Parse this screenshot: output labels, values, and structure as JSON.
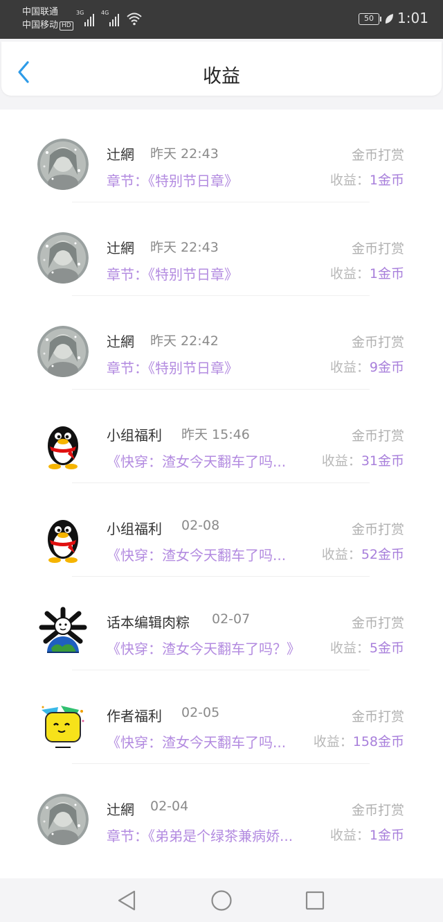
{
  "status_bar": {
    "carrier_1": "中国联通",
    "carrier_2": "中国移动",
    "hd": "HD",
    "net_1": "3G",
    "net_2": "4G",
    "battery": "50",
    "time": "1:01"
  },
  "header": {
    "title": "收益",
    "back_icon": "chevron-left-icon"
  },
  "items": [
    {
      "avatar": "anime-girl",
      "name": "辻網",
      "time": "昨天 22:43",
      "type": "金币打赏",
      "chapter": "章节：《特别节日章》",
      "income_label": "收益：",
      "income_value": "1金币"
    },
    {
      "avatar": "anime-girl",
      "name": "辻網",
      "time": "昨天 22:43",
      "type": "金币打赏",
      "chapter": "章节：《特别节日章》",
      "income_label": "收益：",
      "income_value": "1金币"
    },
    {
      "avatar": "anime-girl",
      "name": "辻網",
      "time": "昨天 22:42",
      "type": "金币打赏",
      "chapter": "章节：《特别节日章》",
      "income_label": "收益：",
      "income_value": "9金币"
    },
    {
      "avatar": "penguin",
      "name": "小组福利",
      "time": "昨天 15:46",
      "type": "金币打赏",
      "chapter": "《快穿：渣女今天翻车了吗...",
      "income_label": "收益：",
      "income_value": "31金币"
    },
    {
      "avatar": "penguin",
      "name": "小组福利",
      "time": "02-08",
      "type": "金币打赏",
      "chapter": "《快穿：渣女今天翻车了吗...",
      "income_label": "收益：",
      "income_value": "52金币"
    },
    {
      "avatar": "earth-skull",
      "name": "话本编辑肉粽",
      "time": "02-07",
      "type": "金币打赏",
      "chapter": "《快穿：渣女今天翻车了吗？》",
      "income_label": "收益：",
      "income_value": "5金币"
    },
    {
      "avatar": "yellow-emoji",
      "name": "作者福利",
      "time": "02-05",
      "type": "金币打赏",
      "chapter": "《快穿：渣女今天翻车了吗...",
      "income_label": "收益：",
      "income_value": "158金币"
    },
    {
      "avatar": "anime-girl",
      "name": "辻網",
      "time": "02-04",
      "type": "金币打赏",
      "chapter": "章节：《弟弟是个绿茶兼病娇...",
      "income_label": "收益：",
      "income_value": "1金币"
    }
  ],
  "colors": {
    "accent": "#2d9be8",
    "chapter": "#b38be0",
    "income_value": "#a87fdb"
  },
  "nav": {
    "back_icon": "triangle-back-icon",
    "home_icon": "circle-home-icon",
    "recent_icon": "square-recent-icon"
  }
}
